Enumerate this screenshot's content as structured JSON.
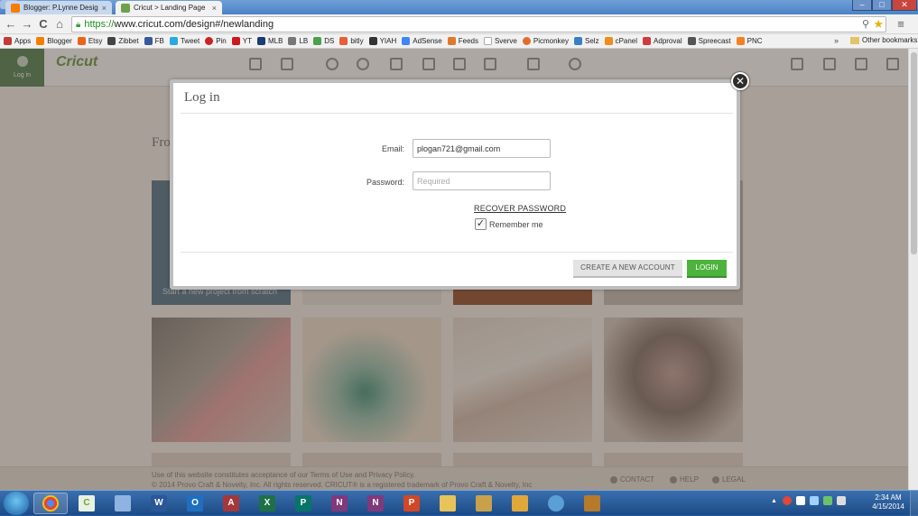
{
  "browser": {
    "tabs": [
      {
        "label": "Blogger: P.Lynne Designs",
        "favicon_color": "#f57d00"
      },
      {
        "label": "Cricut > Landing Page",
        "favicon_color": "#6fa04a"
      }
    ],
    "window_buttons": {
      "minimize": "–",
      "maximize": "□",
      "close": "✕"
    },
    "nav": {
      "back": "←",
      "forward": "→",
      "reload": "C",
      "home": "⌂"
    },
    "url_scheme": "https://",
    "url_rest": "www.cricut.com/design#/newlanding",
    "menu_glyph": "≡",
    "bookmarks": [
      {
        "label": "Apps",
        "color": "#c23a3a"
      },
      {
        "label": "Blogger",
        "color": "#f57d00"
      },
      {
        "label": "Etsy",
        "color": "#e8651c"
      },
      {
        "label": "Zibbet",
        "color": "#444444"
      },
      {
        "label": "FB",
        "color": "#3b5998"
      },
      {
        "label": "Tweet",
        "color": "#2aa9e0"
      },
      {
        "label": "Pin",
        "color": "#cb2027"
      },
      {
        "label": "YT",
        "color": "#cc181e"
      },
      {
        "label": "MLB",
        "color": "#1a3b73"
      },
      {
        "label": "LB",
        "color": "#777777"
      },
      {
        "label": "DS",
        "color": "#4aa14a"
      },
      {
        "label": "bitly",
        "color": "#e5603a"
      },
      {
        "label": "YIAH",
        "color": "#333333"
      },
      {
        "label": "AdSense",
        "color": "#4285f4"
      },
      {
        "label": "Feeds",
        "color": "#e2772a"
      },
      {
        "label": "Sverve",
        "color": "#dddddd"
      },
      {
        "label": "Picmonkey",
        "color": "#e36b2c"
      },
      {
        "label": "Selz",
        "color": "#3a7fc4"
      },
      {
        "label": "cPanel",
        "color": "#f08c1a"
      },
      {
        "label": "Adproval",
        "color": "#d23b3b"
      },
      {
        "label": "Spreecast",
        "color": "#555555"
      },
      {
        "label": "PNC",
        "color": "#f58025"
      }
    ],
    "bookmarks_overflow": "»",
    "other_bookmarks": "Other bookmarks"
  },
  "app": {
    "login_label": "Log in",
    "brand": "Cricut",
    "page_heading_partial": "Fro",
    "tile_caption": "Start a new project from scratch",
    "footer": {
      "line1": "Use of this website constitutes acceptance of our Terms of Use and Privacy Policy.",
      "line2": "© 2014 Provo Craft & Novelty, Inc. All rights reserved. CRICUT® is a registered trademark of Provo Craft & Novelty, Inc",
      "contact": "CONTACT",
      "help": "HELP",
      "legal": "LEGAL"
    }
  },
  "modal": {
    "title": "Log in",
    "close_glyph": "✕",
    "email_label": "Email:",
    "email_value": "plogan721@gmail.com",
    "password_label": "Password:",
    "password_placeholder": "Required",
    "recover_link": "RECOVER PASSWORD",
    "remember_label": "Remember me",
    "remember_checked": true,
    "checkmark": "✓",
    "create_account_button": "CREATE A NEW ACCOUNT",
    "login_button": "LOGIN"
  },
  "taskbar": {
    "apps": [
      {
        "name": "chrome",
        "glyph": "",
        "color": "#e0463a",
        "active": true
      },
      {
        "name": "cricut",
        "glyph": "C",
        "color": "#6fa04a",
        "active": false
      },
      {
        "name": "explorer",
        "glyph": "",
        "color": "#8fb3e0",
        "active": false
      },
      {
        "name": "word",
        "glyph": "W",
        "color": "#2b5797",
        "active": false
      },
      {
        "name": "outlook",
        "glyph": "O",
        "color": "#1f6fc1",
        "active": false
      },
      {
        "name": "access",
        "glyph": "A",
        "color": "#a4373a",
        "active": false
      },
      {
        "name": "excel",
        "glyph": "X",
        "color": "#1e7145",
        "active": false
      },
      {
        "name": "publisher",
        "glyph": "P",
        "color": "#077568",
        "active": false
      },
      {
        "name": "onenote",
        "glyph": "N",
        "color": "#80397b",
        "active": false
      },
      {
        "name": "onenote-alt",
        "glyph": "N",
        "color": "#80397b",
        "active": false
      },
      {
        "name": "powerpoint",
        "glyph": "P",
        "color": "#d24726",
        "active": false
      },
      {
        "name": "folder",
        "glyph": "",
        "color": "#e8c35a",
        "active": false
      },
      {
        "name": "tool",
        "glyph": "",
        "color": "#c9a14a",
        "active": false
      },
      {
        "name": "grid-app",
        "glyph": "",
        "color": "#e0a83a",
        "active": false
      },
      {
        "name": "globe",
        "glyph": "",
        "color": "#5a9fd6",
        "active": false
      },
      {
        "name": "game",
        "glyph": "",
        "color": "#b57a2a",
        "active": false
      }
    ],
    "tray_up": "▲",
    "time": "2:34 AM",
    "date": "4/15/2014"
  }
}
